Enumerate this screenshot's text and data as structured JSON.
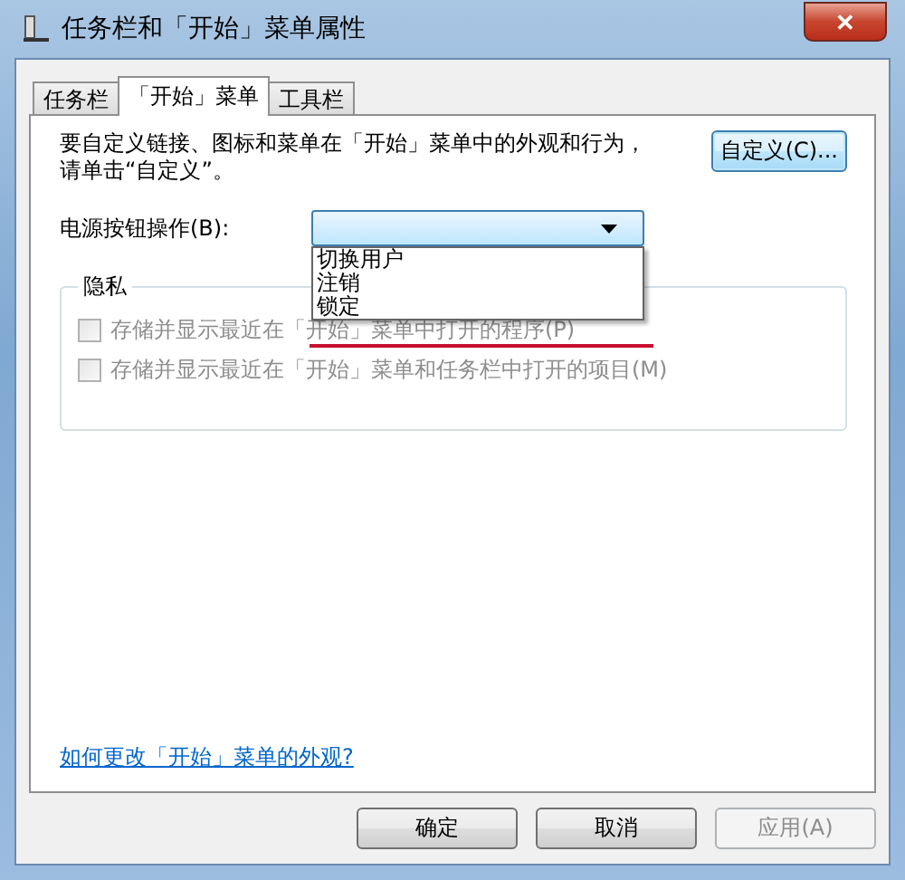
{
  "window": {
    "title": "任务栏和「开始」菜单属性",
    "close": "✕"
  },
  "tabs": [
    {
      "label": "任务栏",
      "selected": false
    },
    {
      "label": "「开始」菜单",
      "selected": true
    },
    {
      "label": "工具栏",
      "selected": false
    }
  ],
  "intro": "要自定义链接、图标和菜单在「开始」菜单中的外观和行为，请单击“自定义”。",
  "customize_button": "自定义(C)...",
  "power_button": {
    "label": "电源按钮操作(B):",
    "expanded": true,
    "options": [
      {
        "label": "切换用户",
        "selected": false
      },
      {
        "label": "注销",
        "selected": false
      },
      {
        "label": "锁定",
        "selected": false
      }
    ]
  },
  "privacy": {
    "title": "隐私",
    "options": [
      {
        "label": "存储并显示最近在「开始」菜单中打开的程序(P)",
        "checked": false,
        "disabled": true
      },
      {
        "label": "存储并显示最近在「开始」菜单和任务栏中打开的项目(M)",
        "checked": false,
        "disabled": true
      }
    ]
  },
  "help_link": "如何更改「开始」菜单的外观?",
  "buttons": [
    {
      "label": "确定",
      "disabled": false
    },
    {
      "label": "取消",
      "disabled": false
    },
    {
      "label": "应用(A)",
      "disabled": true
    }
  ]
}
